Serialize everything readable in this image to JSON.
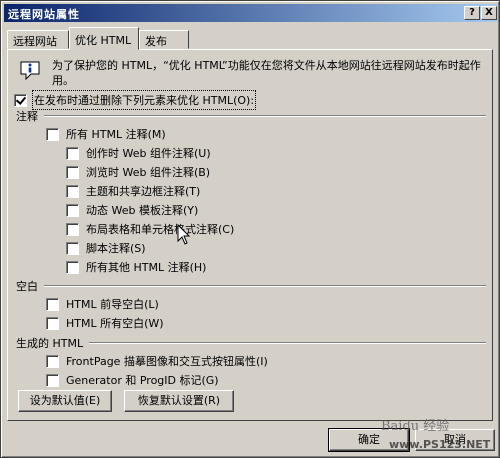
{
  "window": {
    "title": "远程网站属性",
    "help_btn": "?",
    "close_btn": "X"
  },
  "tabs": [
    {
      "label": "远程网站"
    },
    {
      "label": "优化 HTML"
    },
    {
      "label": "发布"
    }
  ],
  "info": {
    "text": "为了保护您的 HTML，“优化 HTML”功能仅在您将文件从本地网站往远程网站发布时起作用。"
  },
  "main_option": {
    "label": "在发布时通过删除下列元素来优化 HTML(O):",
    "checked": true
  },
  "groups": {
    "comments": {
      "title": "注释",
      "all": {
        "label": "所有 HTML 注释(M)",
        "checked": false
      },
      "items": [
        {
          "label": "创作时 Web 组件注释(U)",
          "checked": false
        },
        {
          "label": "浏览时 Web 组件注释(B)",
          "checked": false
        },
        {
          "label": "主题和共享边框注释(T)",
          "checked": false
        },
        {
          "label": "动态 Web 模板注释(Y)",
          "checked": false
        },
        {
          "label": "布局表格和单元格格式注释(C)",
          "checked": false
        },
        {
          "label": "脚本注释(S)",
          "checked": false
        },
        {
          "label": "所有其他 HTML 注释(H)",
          "checked": false
        }
      ]
    },
    "whitespace": {
      "title": "空白",
      "items": [
        {
          "label": "HTML 前导空白(L)",
          "checked": false
        },
        {
          "label": "HTML 所有空白(W)",
          "checked": false
        }
      ]
    },
    "generated": {
      "title": "生成的 HTML",
      "items": [
        {
          "label": "FrontPage 描摹图像和交互式按钮属性(I)",
          "checked": false
        },
        {
          "label": "Generator 和 ProgID 标记(G)",
          "checked": false
        }
      ]
    }
  },
  "buttons": {
    "set_default": "设为默认值(E)",
    "restore_default": "恢复默认设置(R)",
    "ok": "确定",
    "cancel": "取消"
  },
  "watermark": {
    "text": "Baidu 经验",
    "url": "www.PS123.NET"
  },
  "colors": {
    "title_start": "#0a246a",
    "title_end": "#a6caf0",
    "face": "#d4d0c8"
  }
}
